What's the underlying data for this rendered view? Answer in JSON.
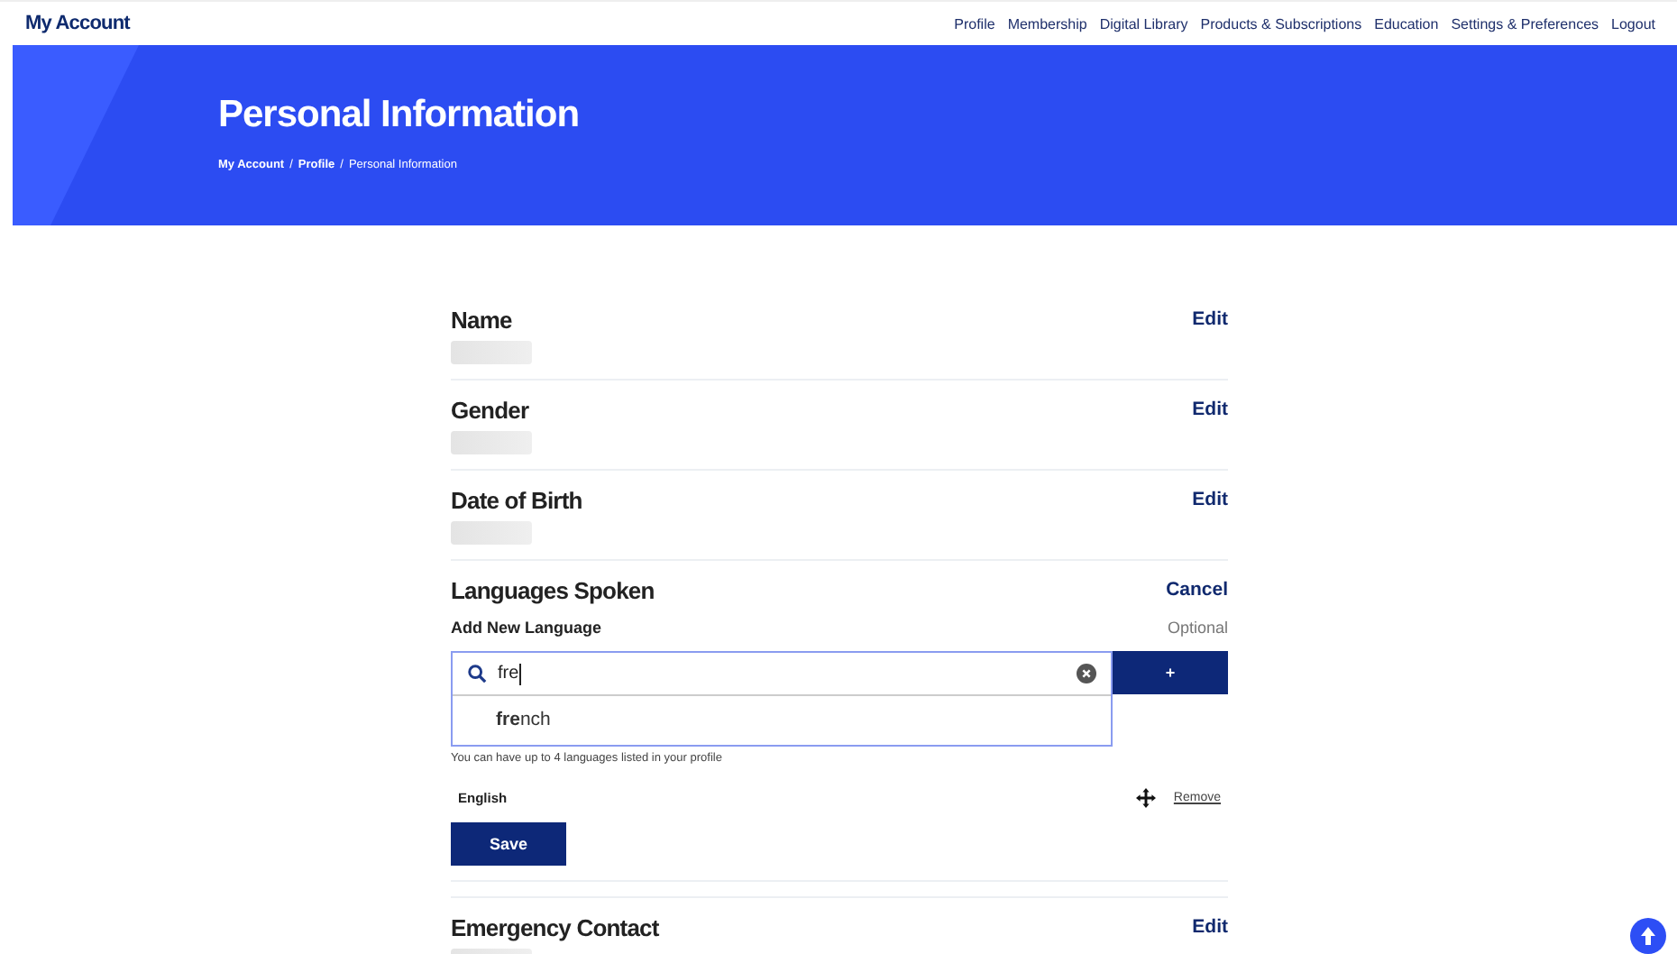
{
  "header": {
    "brand": "My Account",
    "nav": [
      {
        "label": "Profile"
      },
      {
        "label": "Membership"
      },
      {
        "label": "Digital Library"
      },
      {
        "label": "Products & Subscriptions"
      },
      {
        "label": "Education"
      },
      {
        "label": "Settings & Preferences"
      },
      {
        "label": "Logout"
      }
    ]
  },
  "banner": {
    "title": "Personal Information",
    "breadcrumb": [
      {
        "label": "My Account",
        "current": false
      },
      {
        "separator": "/",
        "label": "Profile",
        "current": false
      },
      {
        "separator": "/",
        "label": "Personal Information",
        "current": true
      }
    ]
  },
  "sections_before": [
    {
      "title": "Name",
      "action": "Edit"
    },
    {
      "title": "Gender",
      "action": "Edit"
    },
    {
      "title": "Date of Birth",
      "action": "Edit"
    }
  ],
  "languages": {
    "title": "Languages Spoken",
    "action": "Cancel",
    "field_label": "Add New Language",
    "optional": "Optional",
    "search_value": "fre",
    "add_button": "+",
    "suggestions": [
      "**fre**nch"
    ],
    "hint": "You can have up to 4 languages listed in your profile",
    "items": [
      {
        "name": "English",
        "remove": "Remove"
      }
    ],
    "save": "Save"
  },
  "sections_after": [
    {
      "title": "Emergency Contact",
      "action": "Edit"
    }
  ]
}
